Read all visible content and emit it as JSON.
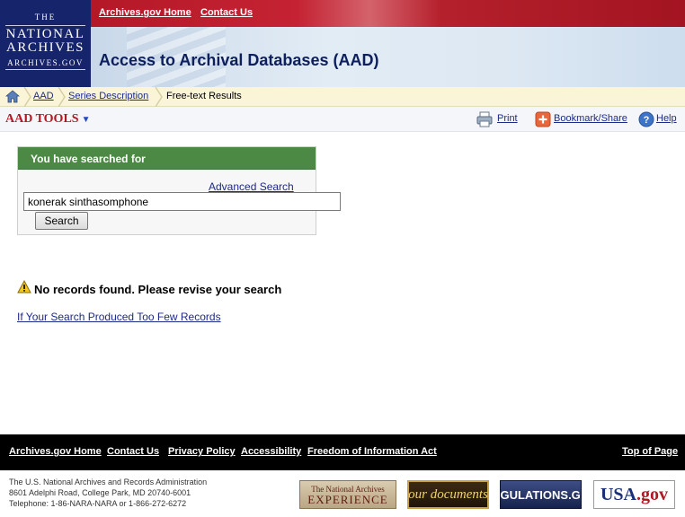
{
  "logo": {
    "line1": "THE",
    "line2": "NATIONAL",
    "line3": "ARCHIVES",
    "line4": "ARCHIVES.GOV"
  },
  "topnav": {
    "home_link": "Archives.gov Home",
    "contact_link": "Contact Us"
  },
  "page": {
    "title": "Access to Archival Databases (AAD)"
  },
  "breadcrumb": {
    "items": [
      {
        "label": "AAD"
      },
      {
        "label": "Series Description"
      },
      {
        "label": "Free-text Results"
      }
    ]
  },
  "toolbar": {
    "aad_tools": "AAD TOOLS",
    "print": "Print",
    "bookmark": "Bookmark/Share",
    "help": "Help"
  },
  "search": {
    "header": "You have searched for",
    "advanced_link": "Advanced Search",
    "query": "konerak sinthasomphone",
    "button": "Search"
  },
  "results": {
    "message": "No records found. Please revise your search",
    "help_link": "If Your Search Produced Too Few Records"
  },
  "footer": {
    "links": [
      "Archives.gov Home",
      "Contact Us",
      "Privacy Policy",
      "Accessibility",
      "Freedom of Information Act"
    ],
    "top_link": "Top of Page",
    "address": [
      "The U.S. National Archives and Records Administration",
      "8601 Adelphi Road, College Park, MD 20740-6001",
      "Telephone: 1-86-NARA-NARA or 1-866-272-6272"
    ],
    "badges": {
      "nae_line1": "The National Archives",
      "nae_line2": "EXPERIENCE",
      "ourdocuments": "our documents",
      "regulations": "REGULATIONS.GOV",
      "usa_main": "USA",
      "usa_suffix": ".gov"
    }
  },
  "colors": {
    "navy": "#16246b",
    "red": "#b41826",
    "green_header": "#4c8945",
    "link": "#1e2a8a",
    "tools_red": "#b01923"
  },
  "icons": [
    "home-icon",
    "print-icon",
    "bookmark-icon",
    "help-icon",
    "warning-icon",
    "chevron-down-icon",
    "breadcrumb-separator-icon"
  ]
}
